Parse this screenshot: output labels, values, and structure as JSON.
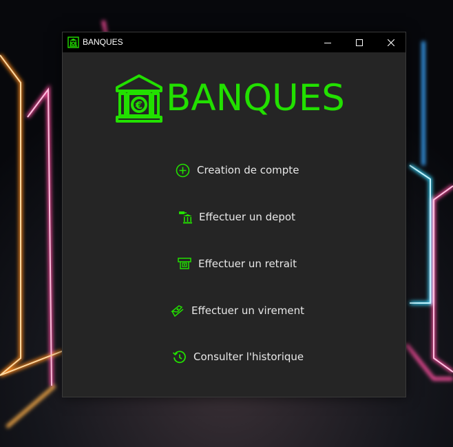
{
  "colors": {
    "accent": "#22e000",
    "window_bg": "#252525",
    "titlebar_bg": "#000000",
    "text": "#e8e8e8"
  },
  "window": {
    "title": "BANQUES",
    "icon": "bank-icon",
    "controls": {
      "minimize": "minimize-icon",
      "maximize": "maximize-icon",
      "close": "close-icon"
    }
  },
  "brand": {
    "title": "BANQUES",
    "logo": "bank-euro-icon"
  },
  "menu": [
    {
      "label": "Creation de compte",
      "icon": "plus-circle-icon"
    },
    {
      "label": "Effectuer un depot",
      "icon": "deposit-bank-icon"
    },
    {
      "label": "Effectuer un retrait",
      "icon": "withdraw-cash-icon"
    },
    {
      "label": "Effectuer un virement",
      "icon": "transfer-icon"
    },
    {
      "label": "Consulter l'historique",
      "icon": "history-icon"
    }
  ]
}
